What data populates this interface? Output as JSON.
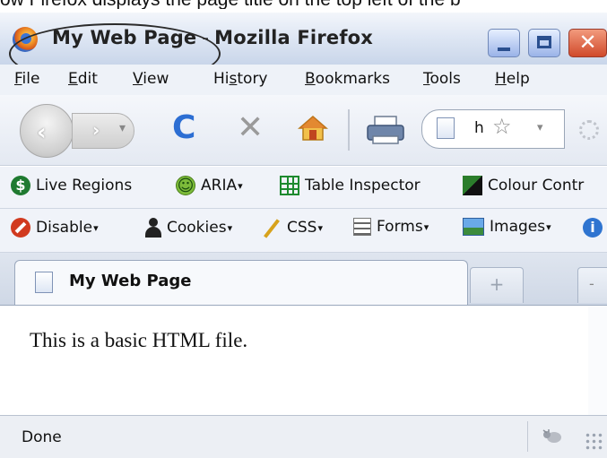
{
  "window": {
    "title_page": "My Web Page",
    "title_separator": "-",
    "title_app": "Mozilla Firefox",
    "minimize_label": "",
    "maximize_label": "",
    "close_label": "✕"
  },
  "caption_fragment": "ow Firefox displays the page title on the top left of the b",
  "menu": {
    "items": [
      {
        "first": "F",
        "rest": "ile"
      },
      {
        "first": "E",
        "rest": "dit"
      },
      {
        "first": "V",
        "rest": "iew"
      },
      {
        "pre": "Hi",
        "first": "s",
        "rest": "tory"
      },
      {
        "first": "B",
        "rest": "ookmarks"
      },
      {
        "first": "T",
        "rest": "ools"
      },
      {
        "first": "H",
        "rest": "elp"
      }
    ]
  },
  "navigation": {
    "back_glyph": "‹",
    "forward_glyph": "›",
    "forward_dropdown": "▾",
    "reload_glyph": "C",
    "stop_glyph": "✕",
    "url_value": "h",
    "bookmark_star": "☆",
    "url_dropdown": "▾"
  },
  "accessibility_toolbar": {
    "live_regions": "Live Regions",
    "aria": "ARIA",
    "table_inspector": "Table Inspector",
    "colour_contrast": "Colour Contr"
  },
  "webdev_toolbar": {
    "disable": "Disable",
    "cookies": "Cookies",
    "css": "CSS",
    "forms": "Forms",
    "images": "Images",
    "info_glyph": "i",
    "caret": "▾"
  },
  "tabs": {
    "active_title": "My Web Page",
    "new_tab_glyph": "+",
    "list_glyph": "-"
  },
  "content": {
    "body_text": "This is a basic HTML file."
  },
  "status": {
    "text": "Done"
  },
  "colors": {
    "accent_blue": "#2c6ed3",
    "close_red": "#d04a2b"
  }
}
